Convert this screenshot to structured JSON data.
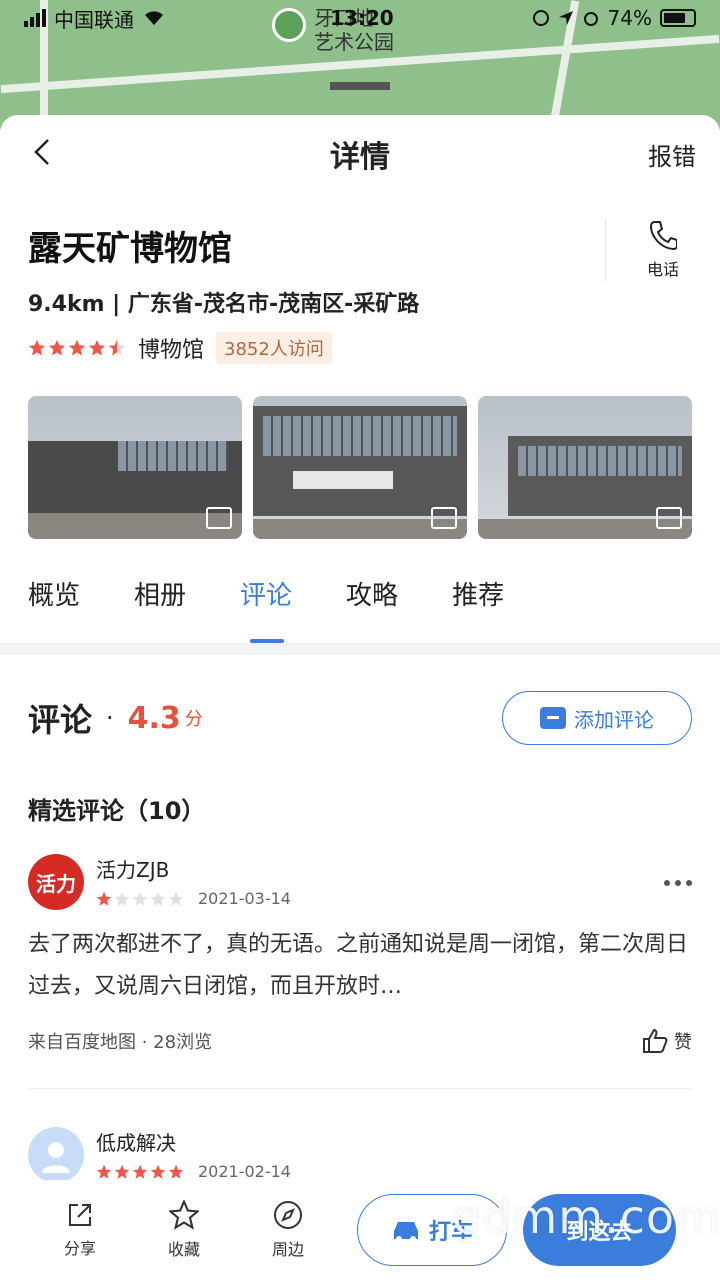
{
  "status_bar": {
    "carrier": "中国联通",
    "time": "13:20",
    "battery": "74%"
  },
  "map": {
    "label_line1": "牙口地",
    "label_line2": "艺术公园"
  },
  "nav": {
    "title": "详情",
    "report": "报错"
  },
  "poi": {
    "name": "露天矿博物馆",
    "address": "9.4km | 广东省-茂名市-茂南区-采矿路",
    "rating_stars": 4.5,
    "category": "博物馆",
    "visits": "3852人访问",
    "call_label": "电话"
  },
  "tabs": [
    {
      "label": "概览"
    },
    {
      "label": "相册"
    },
    {
      "label": "评论",
      "active": true
    },
    {
      "label": "攻略"
    },
    {
      "label": "推荐"
    }
  ],
  "reviews_section": {
    "title": "评论",
    "dot": "·",
    "score": "4.3",
    "score_unit": "分",
    "add_button": "添加评论",
    "featured_title": "精选评论（10）"
  },
  "reviews": [
    {
      "user": "活力ZJB",
      "avatar_text": "活力",
      "stars": 1,
      "date": "2021-03-14",
      "text": "去了两次都进不了，真的无语。之前通知说是周一闭馆，第二次周日过去，又说周六日闭馆，而且开放时…",
      "source": "来自百度地图 · 28浏览",
      "like": "赞"
    },
    {
      "user": "低成解决",
      "stars": 5,
      "date": "2021-02-14"
    }
  ],
  "bottom_bar": {
    "share": "分享",
    "favorite": "收藏",
    "nearby": "周边",
    "taxi": "打车",
    "go": "到这去"
  },
  "watermark": "gdmm.com",
  "colors": {
    "accent": "#3b7ddd",
    "rating": "#e4513d",
    "visits_bg": "#fbeee5"
  }
}
